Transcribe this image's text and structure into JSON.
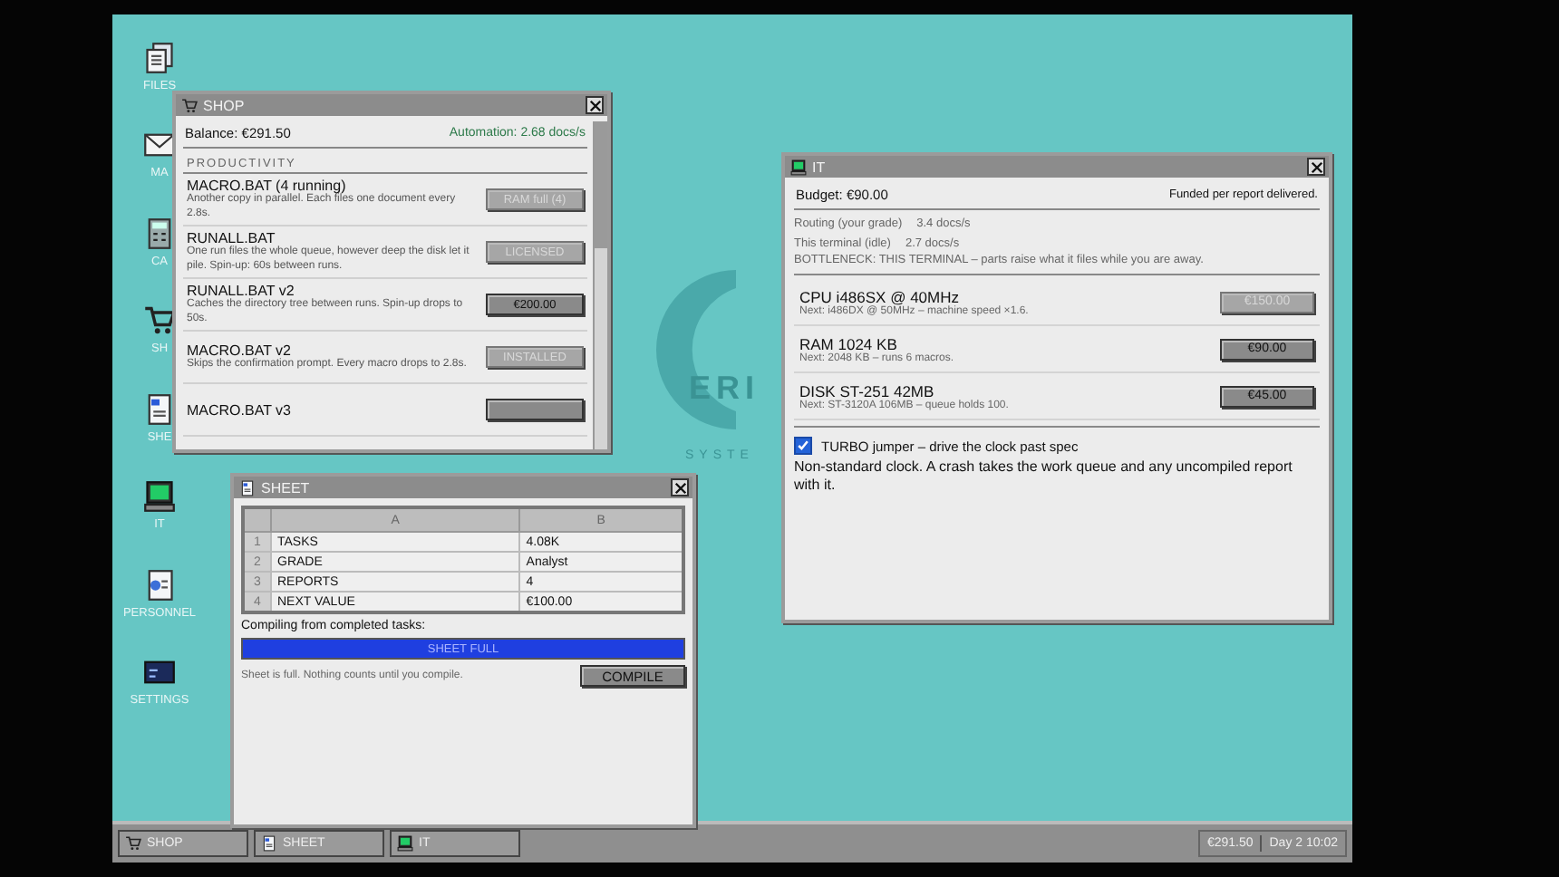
{
  "desktop_icons": [
    {
      "label": "FILES",
      "kind": "files"
    },
    {
      "label": "MA",
      "kind": "mail"
    },
    {
      "label": "CA",
      "kind": "calc"
    },
    {
      "label": "SH",
      "kind": "shop"
    },
    {
      "label": "SHE",
      "kind": "sheet"
    },
    {
      "label": "IT",
      "kind": "it"
    },
    {
      "label": "PERSONNEL",
      "kind": "personnel"
    },
    {
      "label": "SETTINGS",
      "kind": "settings"
    }
  ],
  "wallpaper_logo": {
    "text": "ERI",
    "subtext": "SYSTE"
  },
  "shop": {
    "title": "SHOP",
    "balance": "Balance: €291.50",
    "automation": "Automation: 2.68 docs/s",
    "section": "PRODUCTIVITY",
    "items": [
      {
        "name": "MACRO.BAT (4 running)",
        "description": "Another copy in parallel. Each files one document every 2.8s.",
        "button": "RAM full (4)",
        "disabled": true
      },
      {
        "name": "RUNALL.BAT",
        "description": "One run files the whole queue, however deep the disk let it pile. Spin-up: 60s between runs.",
        "button": "LICENSED",
        "disabled": true
      },
      {
        "name": "RUNALL.BAT v2",
        "description": "Caches the directory tree between runs. Spin-up drops to 50s.",
        "button": "€200.00",
        "disabled": false
      },
      {
        "name": "MACRO.BAT v2",
        "description": "Skips the confirmation prompt. Every macro drops to 2.8s.",
        "button": "INSTALLED",
        "disabled": true
      },
      {
        "name": "MACRO.BAT v3",
        "disabled": false
      }
    ]
  },
  "sheet": {
    "title": "SHEET",
    "columns": [
      "A",
      "B"
    ],
    "rows": [
      {
        "num": "1",
        "key": "TASKS",
        "value": "4.08K"
      },
      {
        "num": "2",
        "key": "GRADE",
        "value": "Analyst"
      },
      {
        "num": "3",
        "key": "REPORTS",
        "value": "4"
      },
      {
        "num": "4",
        "key": "NEXT VALUE",
        "value": "€100.00"
      }
    ],
    "progress_label": "Compiling from completed tasks:",
    "progress": {
      "level": 1,
      "text": "SHEET FULL"
    },
    "note": "Sheet is full. Nothing counts until you compile.",
    "button": "COMPILE"
  },
  "it": {
    "title": "IT",
    "budget": "Budget: €90.00",
    "funding": "Funded per report delivered.",
    "stats": [
      {
        "label": "Routing (your grade)",
        "value": "3.4 docs/s"
      },
      {
        "label": "This terminal (idle)",
        "value": "2.7 docs/s"
      }
    ],
    "bottleneck": "BOTTLENECK: THIS TERMINAL – parts raise what it files while you are away.",
    "parts": [
      {
        "name": "CPU i486SX @ 40MHz",
        "next": "Next: i486DX @ 50MHz – machine speed ×1.6.",
        "button": "€150.00",
        "disabled": true
      },
      {
        "name": "RAM 1024 KB",
        "next": "Next: 2048 KB – runs 6 macros.",
        "button": "€90.00",
        "disabled": false
      },
      {
        "name": "DISK ST-251 42MB",
        "next": "Next: ST-3120A 106MB – queue holds 100.",
        "button": "€45.00",
        "disabled": false
      }
    ],
    "turbo": {
      "label": "TURBO jumper – drive the clock past spec",
      "checked": true
    },
    "warning": "Non-standard clock. A crash takes the work queue and any uncompiled report with it."
  },
  "taskbar": {
    "buttons": [
      {
        "label": "SHOP",
        "kind": "shop"
      },
      {
        "label": "SHEET",
        "kind": "sheet"
      },
      {
        "label": "IT",
        "kind": "it"
      }
    ],
    "money": "€291.50",
    "clock": "Day 2 10:02"
  }
}
